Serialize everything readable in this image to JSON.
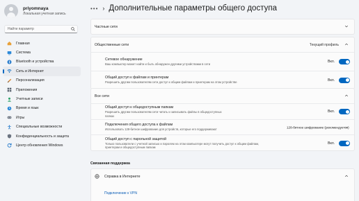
{
  "profile": {
    "name": "priyomnaya",
    "subtitle": "Локальная учетная запись"
  },
  "search": {
    "placeholder": "Найти параметр"
  },
  "nav": [
    {
      "label": "Главная",
      "icon": "home-icon"
    },
    {
      "label": "Система",
      "icon": "system-icon"
    },
    {
      "label": "Bluetooth и устройства",
      "icon": "bluetooth-icon"
    },
    {
      "label": "Сеть и Интернет",
      "icon": "network-icon",
      "active": true
    },
    {
      "label": "Персонализация",
      "icon": "brush-icon"
    },
    {
      "label": "Приложения",
      "icon": "apps-icon"
    },
    {
      "label": "Учетные записи",
      "icon": "accounts-icon"
    },
    {
      "label": "Время и язык",
      "icon": "globe-clock-icon"
    },
    {
      "label": "Игры",
      "icon": "gamepad-icon"
    },
    {
      "label": "Специальные возможности",
      "icon": "accessibility-icon"
    },
    {
      "label": "Конфиденциальность и защита",
      "icon": "shield-icon"
    },
    {
      "label": "Центр обновления Windows",
      "icon": "update-icon"
    }
  ],
  "header": {
    "dots": "•••",
    "separator": "›",
    "title": "Дополнительные параметры общего доступа"
  },
  "private": {
    "label": "Частные сети"
  },
  "public": {
    "label": "Общественные сети",
    "badge": "Текущий профиль",
    "discovery": {
      "title": "Сетевое обнаружение",
      "desc": "Ваш компьютер может найти и быть обнаружен другими устройствами в сети",
      "state": "Вкл."
    },
    "file_sharing": {
      "title": "Общий доступ к файлам и принтерам",
      "desc": "Разрешить другим пользователям сети доступ к общим файлам и принтерам на этом устройстве",
      "state": "Вкл."
    }
  },
  "all": {
    "label": "Все сети",
    "public_folders": {
      "title": "Общий доступ к общедоступным папкам",
      "desc1": "Разрешить другим пользователям сети читать и записывать файлы в общедоступных",
      "desc2": "папках",
      "state": "Вкл."
    },
    "encryption": {
      "title": "Подключения общего доступа к файлам",
      "desc": "Использовать 128-битное шифрование для устройств, которые его поддерживают",
      "value": "128-битное шифрование (рекомендуется)"
    },
    "password": {
      "title": "Общий доступ с парольной защитой",
      "desc1": "Только пользователи с учетной записью и паролем на этом компьютере могут получить доступ к общим файлам,",
      "desc2": "принтерам и общедоступным папкам",
      "state": "Вкл."
    }
  },
  "support": {
    "section": "Связанная поддержка",
    "help": "Справка в Интернете",
    "vpn_link": "Подключение к VPN"
  },
  "colors": {
    "accent": "#0067c0",
    "background": "#f2f4f7",
    "card": "#fbfbfb"
  }
}
